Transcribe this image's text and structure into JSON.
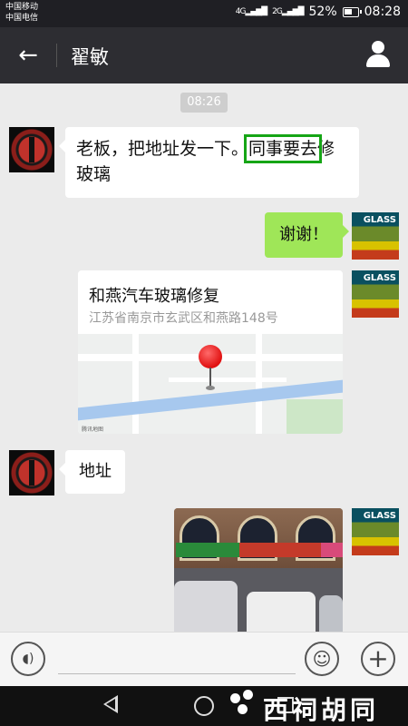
{
  "status_bar": {
    "carrier_1": "中国移动",
    "carrier_2": "中国电信",
    "signal_1": "4G",
    "signal_2": "2G",
    "battery": "52%",
    "time": "08:28"
  },
  "header": {
    "back_icon": "arrow-left",
    "title": "翟敏",
    "profile_icon": "person"
  },
  "chat": {
    "timestamp": "08:26",
    "messages": [
      {
        "side": "left",
        "text_before": "老板，把地址发一下。",
        "text_highlight": "同事要去",
        "text_after": "修玻璃"
      },
      {
        "side": "right",
        "text": "谢谢！"
      },
      {
        "side": "right",
        "type": "location",
        "title": "和燕汽车玻璃修复",
        "address": "江苏省南京市玄武区和燕路148号",
        "map_logo": "腾讯地图"
      },
      {
        "side": "left",
        "text": "地址"
      },
      {
        "side": "right",
        "type": "image"
      }
    ]
  },
  "right_avatar": {
    "logo_text": "GLASS"
  },
  "input_bar": {
    "voice_icon": "voice",
    "emoji_icon": "emoji",
    "plus_icon": "plus"
  },
  "nav_bar": {
    "back_icon": "triangle-back",
    "home_icon": "circle-home",
    "recent_icon": "square-recent"
  },
  "watermark": {
    "text": "西祠胡同"
  },
  "colors": {
    "header_bg": "#2d2d32",
    "chat_bg": "#ebebeb",
    "sent_bubble": "#9fe658",
    "highlight_box": "#16a516"
  }
}
